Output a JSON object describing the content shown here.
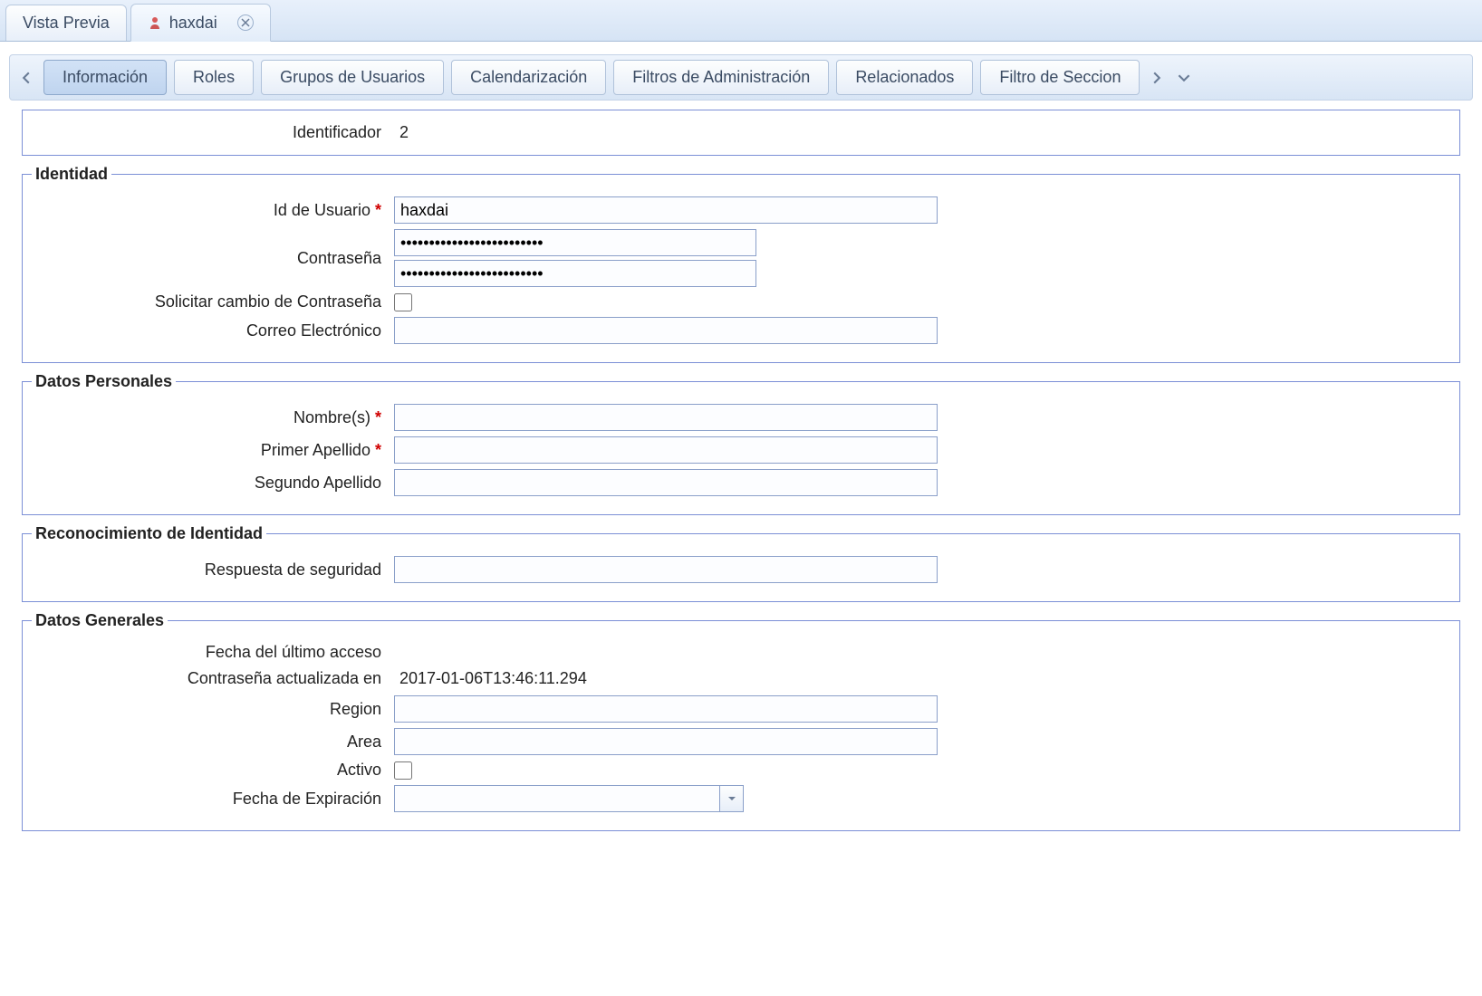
{
  "windowTabs": {
    "tab0": {
      "label": "Vista Previa"
    },
    "tab1": {
      "label": "haxdai"
    }
  },
  "subTabs": {
    "t0": "Información",
    "t1": "Roles",
    "t2": "Grupos de Usuarios",
    "t3": "Calendarización",
    "t4": "Filtros de Administración",
    "t5": "Relacionados",
    "t6": "Filtro de Seccion"
  },
  "fields": {
    "identificador": {
      "label": "Identificador",
      "value": "2"
    },
    "idUsuario": {
      "label": "Id de Usuario",
      "value": "haxdai"
    },
    "password": {
      "label": "Contraseña",
      "value1": "•••••••••••••••••••••••••",
      "value2": "•••••••••••••••••••••••••"
    },
    "cambioPwd": {
      "label": "Solicitar cambio de Contraseña",
      "checked": false
    },
    "correo": {
      "label": "Correo Electrónico",
      "value": ""
    },
    "nombres": {
      "label": "Nombre(s)",
      "value": ""
    },
    "apellido1": {
      "label": "Primer Apellido",
      "value": ""
    },
    "apellido2": {
      "label": "Segundo Apellido",
      "value": ""
    },
    "respSeg": {
      "label": "Respuesta de seguridad",
      "value": ""
    },
    "ultimoAcceso": {
      "label": "Fecha del último acceso",
      "value": ""
    },
    "pwdActualizada": {
      "label": "Contraseña actualizada en",
      "value": "2017-01-06T13:46:11.294"
    },
    "region": {
      "label": "Region",
      "value": ""
    },
    "area": {
      "label": "Area",
      "value": ""
    },
    "activo": {
      "label": "Activo",
      "checked": false
    },
    "expiracion": {
      "label": "Fecha de Expiración",
      "value": ""
    }
  },
  "groups": {
    "identidad": "Identidad",
    "datosPersonales": "Datos Personales",
    "reconocimiento": "Reconocimiento de Identidad",
    "datosGenerales": "Datos Generales"
  }
}
